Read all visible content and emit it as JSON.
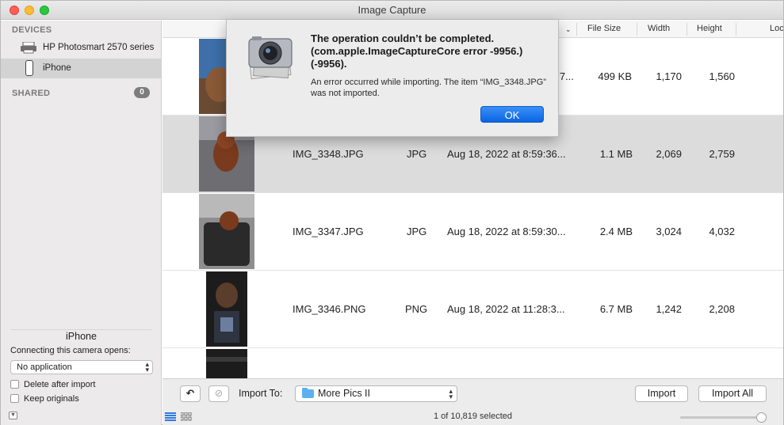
{
  "window": {
    "title": "Image Capture"
  },
  "sidebar": {
    "devices_header": "DEVICES",
    "devices": [
      {
        "label": "HP Photosmart 2570 series",
        "icon": "printer-icon"
      },
      {
        "label": "iPhone",
        "icon": "iphone-icon"
      }
    ],
    "shared_header": "SHARED",
    "shared_count": "0",
    "device_name": "iPhone",
    "opens_label": "Connecting this camera opens:",
    "opens_value": "No application",
    "delete_after_import": "Delete after import",
    "keep_originals": "Keep originals"
  },
  "columns": {
    "file_size": "File Size",
    "width": "Width",
    "height": "Height",
    "location": "Loc"
  },
  "rows": [
    {
      "name": "",
      "kind": "",
      "date": "...7...",
      "size": "499 KB",
      "width": "1,170",
      "height": "1,560"
    },
    {
      "name": "IMG_3348.JPG",
      "kind": "JPG",
      "date": "Aug 18, 2022 at 8:59:36...",
      "size": "1.1 MB",
      "width": "2,069",
      "height": "2,759"
    },
    {
      "name": "IMG_3347.JPG",
      "kind": "JPG",
      "date": "Aug 18, 2022 at 8:59:30...",
      "size": "2.4 MB",
      "width": "3,024",
      "height": "4,032"
    },
    {
      "name": "IMG_3346.PNG",
      "kind": "PNG",
      "date": "Aug 18, 2022 at 11:28:3...",
      "size": "6.7 MB",
      "width": "1,242",
      "height": "2,208"
    }
  ],
  "bottombar": {
    "import_to_label": "Import To:",
    "folder": "More Pics II",
    "import_button": "Import",
    "import_all_button": "Import All",
    "status": "1 of 10,819 selected"
  },
  "alert": {
    "title": "The operation couldn’t be completed. (com.apple.ImageCaptureCore error -9956.) (-9956).",
    "message": "An error occurred while importing. The item “IMG_3348.JPG” was not imported.",
    "ok_button": "OK"
  },
  "colors": {
    "accent": "#0a64e0",
    "selection": "#dcdcdc"
  }
}
